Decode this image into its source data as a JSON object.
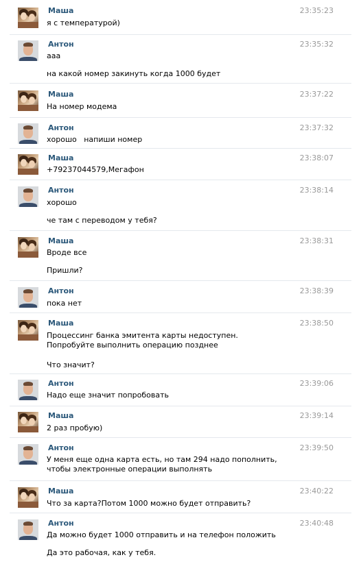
{
  "messages": [
    {
      "author": "Маша",
      "time": "23:35:23",
      "lines": [
        "я с температурой)"
      ]
    },
    {
      "author": "Антон",
      "time": "23:35:32",
      "lines": [
        "ааа",
        "на какой номер закинуть когда 1000 будет"
      ]
    },
    {
      "author": "Маша",
      "time": "23:37:22",
      "lines": [
        "На номер модема"
      ]
    },
    {
      "author": "Антон",
      "time": "23:37:32",
      "lines": [
        "хорошо   напиши номер"
      ]
    },
    {
      "author": "Маша",
      "time": "23:38:07",
      "lines": [
        "+79237044579,Мегафон"
      ]
    },
    {
      "author": "Антон",
      "time": "23:38:14",
      "lines": [
        "хорошо",
        "че там с переводом у тебя?"
      ]
    },
    {
      "author": "Маша",
      "time": "23:38:31",
      "lines": [
        "Вроде все",
        "Пришли?"
      ]
    },
    {
      "author": "Антон",
      "time": "23:38:39",
      "lines": [
        "пока нет"
      ]
    },
    {
      "author": "Маша",
      "time": "23:38:50",
      "lines": [
        "Процессинг банка эмитента карты недоступен. Попробуйте выполнить операцию позднее",
        "Что значит?"
      ]
    },
    {
      "author": "Антон",
      "time": "23:39:06",
      "lines": [
        "Надо еще значит попробовать"
      ]
    },
    {
      "author": "Маша",
      "time": "23:39:14",
      "lines": [
        "2 раз пробую)"
      ]
    },
    {
      "author": "Антон",
      "time": "23:39:50",
      "lines": [
        "У меня еще одна карта есть, но там 294 надо пополнить, чтобы электронные операции выполнять"
      ]
    },
    {
      "author": "Маша",
      "time": "23:40:22",
      "lines": [
        "Что за карта?Потом 1000 можно будет отправить?"
      ]
    },
    {
      "author": "Антон",
      "time": "23:40:48",
      "lines": [
        "Да можно будет 1000 отправить и на телефон положить",
        "Да это рабочая, как у тебя."
      ]
    }
  ]
}
